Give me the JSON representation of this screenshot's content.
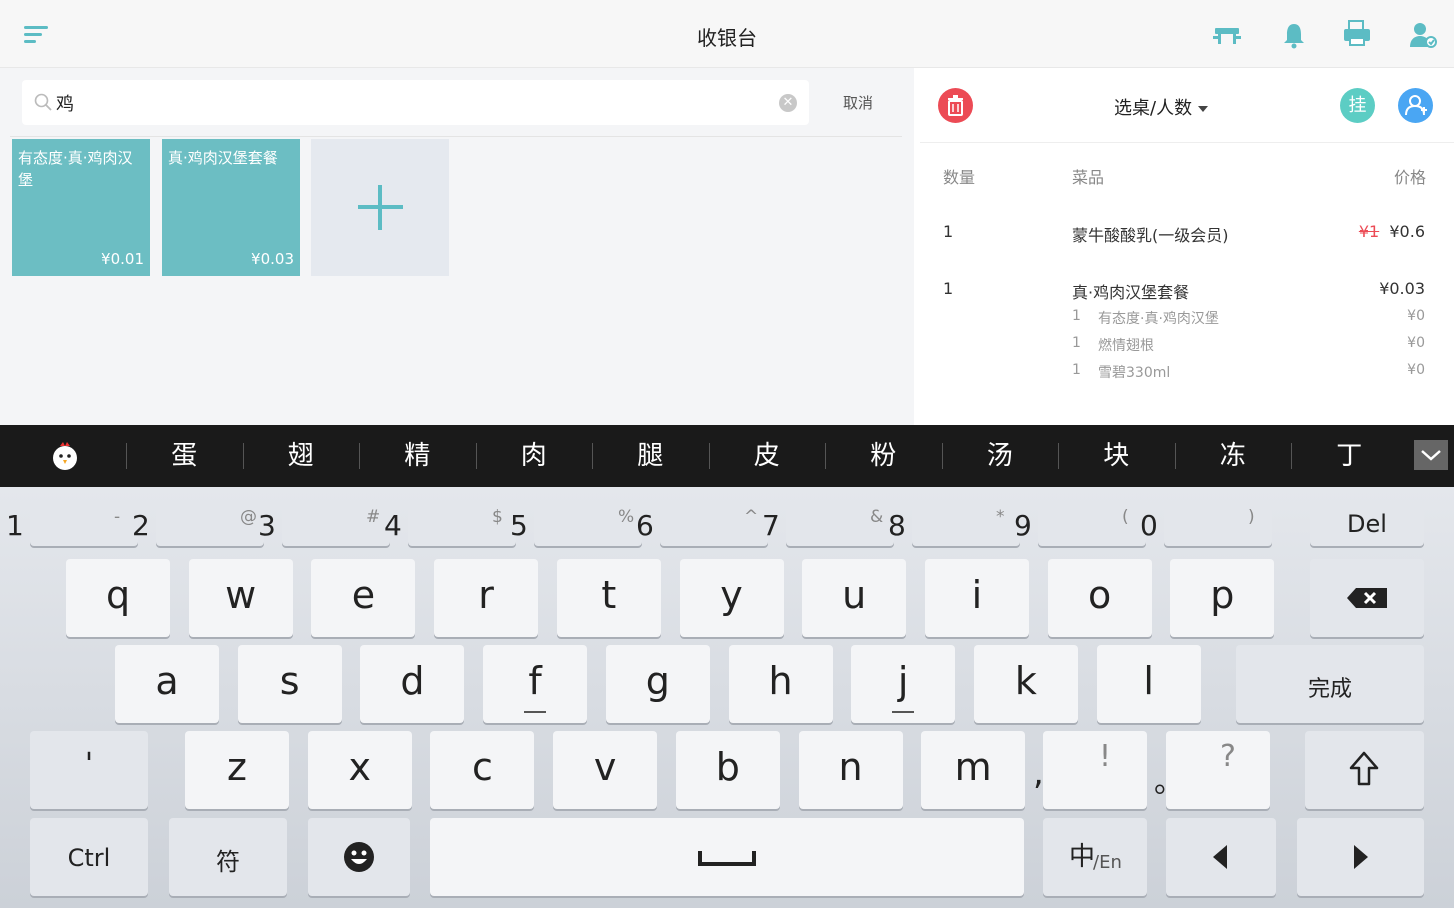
{
  "header": {
    "title": "收银台",
    "icons": [
      "menu-icon",
      "table-icon",
      "bell-icon",
      "printer-icon",
      "staff-icon"
    ]
  },
  "search": {
    "value": "鸡",
    "placeholder": "",
    "cancel_label": "取消"
  },
  "products": [
    {
      "name": "有态度·真·鸡肉汉堡",
      "price": "¥0.01"
    },
    {
      "name": "真·鸡肉汉堡套餐",
      "price": "¥0.03"
    }
  ],
  "order": {
    "table_select_label": "选桌/人数",
    "hang_label": "挂",
    "columns": {
      "qty": "数量",
      "item": "菜品",
      "price": "价格"
    },
    "items": [
      {
        "qty": "1",
        "name": "蒙牛酸酸乳(一级会员)",
        "original_price": "¥1",
        "price": "¥0.6"
      },
      {
        "qty": "1",
        "name": "真·鸡肉汉堡套餐",
        "price": "¥0.03",
        "sub_items": [
          {
            "qty": "1",
            "name": "有态度·真·鸡肉汉堡",
            "price": "¥0"
          },
          {
            "qty": "1",
            "name": "燃情翅根",
            "price": "¥0"
          },
          {
            "qty": "1",
            "name": "雪碧330ml",
            "price": "¥0"
          }
        ]
      }
    ]
  },
  "ime": {
    "candidates": [
      "蛋",
      "翅",
      "精",
      "肉",
      "腿",
      "皮",
      "粉",
      "汤",
      "块",
      "冻",
      "丁"
    ]
  },
  "keyboard": {
    "number_row": [
      {
        "main": "1",
        "sub": "-"
      },
      {
        "main": "2",
        "sub": "@"
      },
      {
        "main": "3",
        "sub": "#"
      },
      {
        "main": "4",
        "sub": "$"
      },
      {
        "main": "5",
        "sub": "%"
      },
      {
        "main": "6",
        "sub": "^"
      },
      {
        "main": "7",
        "sub": "&"
      },
      {
        "main": "8",
        "sub": "*"
      },
      {
        "main": "9",
        "sub": "("
      },
      {
        "main": "0",
        "sub": ")"
      }
    ],
    "del_label": "Del",
    "row_q": [
      "q",
      "w",
      "e",
      "r",
      "t",
      "y",
      "u",
      "i",
      "o",
      "p"
    ],
    "row_a": [
      "a",
      "s",
      "d",
      "f",
      "g",
      "h",
      "j",
      "k",
      "l"
    ],
    "done_label": "完成",
    "apostrophe": "'",
    "row_z": [
      "z",
      "x",
      "c",
      "v",
      "b",
      "n",
      "m"
    ],
    "comma_key": {
      "main": ",",
      "sub": "!"
    },
    "period_key": {
      "main": "。",
      "sub": "?"
    },
    "ctrl_label": "Ctrl",
    "symbol_label": "符",
    "lang_label_main": "中",
    "lang_label_sub": "/En"
  },
  "colors": {
    "accent": "#5cbcc4",
    "tile": "#6cbec3",
    "danger": "#ec4b55",
    "member": "#4aa6f3"
  }
}
